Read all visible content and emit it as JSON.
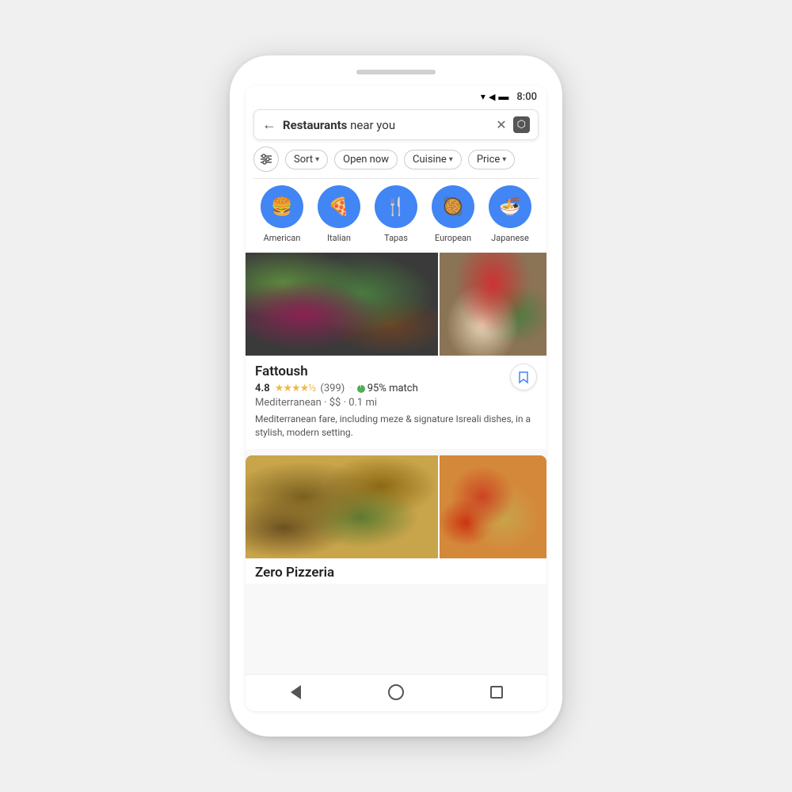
{
  "phone": {
    "status_bar": {
      "time": "8:00",
      "wifi": "▾",
      "signal": "▲",
      "battery": "▪"
    },
    "search": {
      "placeholder": "Restaurants near you",
      "bold_part": "Restaurants",
      "rest": " near you",
      "back_icon": "←",
      "clear_icon": "✕",
      "map_icon": "⬡"
    },
    "filters": {
      "filter_icon_label": "sliders",
      "chips": [
        {
          "label": "Sort",
          "has_arrow": true
        },
        {
          "label": "Open now",
          "has_arrow": false
        },
        {
          "label": "Cuisine",
          "has_arrow": true
        },
        {
          "label": "Price",
          "has_arrow": true
        }
      ]
    },
    "categories": [
      {
        "label": "American",
        "icon": "🍔"
      },
      {
        "label": "Italian",
        "icon": "🍕"
      },
      {
        "label": "Tapas",
        "icon": "🍴"
      },
      {
        "label": "European",
        "icon": "🥘"
      },
      {
        "label": "Japanese",
        "icon": "🍜"
      }
    ],
    "restaurants": [
      {
        "name": "Fattoush",
        "rating": "4.8",
        "stars_full": 4,
        "stars_half": true,
        "review_count": "(399)",
        "match": "95% match",
        "cuisine": "Mediterranean",
        "price": "$$",
        "distance": "0.1 mi",
        "description": "Mediterranean fare, including meze & signature Isreali dishes, in a stylish, modern setting.",
        "img_class_main": "fattoush-main",
        "img_class_side": "fattoush-side"
      },
      {
        "name": "Zero Pizzeria",
        "rating": "",
        "description": "",
        "img_class_main": "pizza-main",
        "img_class_side": "pizza-side",
        "partial": true
      }
    ],
    "nav": {
      "back_label": "back",
      "home_label": "home",
      "recents_label": "recents"
    }
  }
}
